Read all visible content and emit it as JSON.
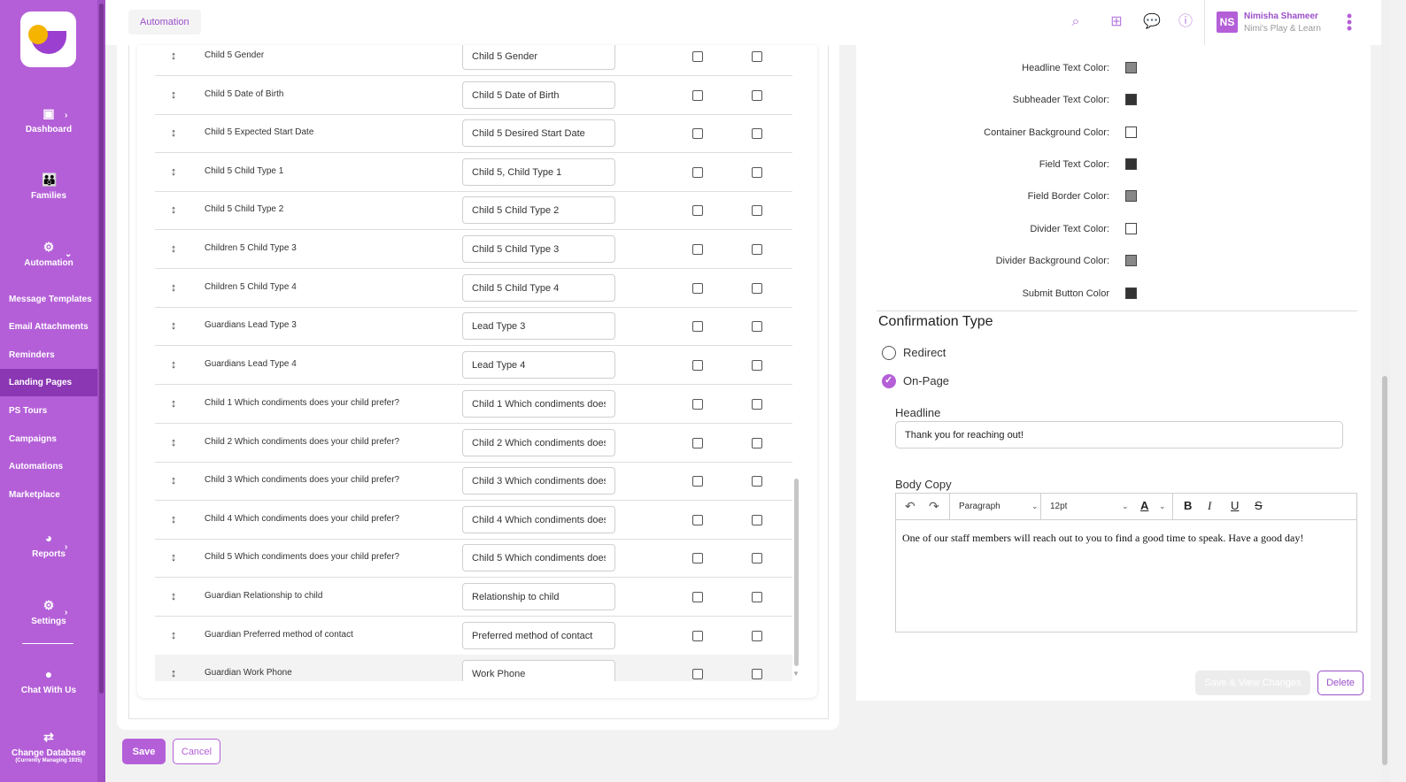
{
  "app": {
    "breadcrumb": "Automation",
    "user": {
      "initials": "NS",
      "name": "Nimisha Shameer",
      "org": "Nimi's Play & Learn"
    }
  },
  "sidebar": {
    "main": [
      {
        "label": "Dashboard",
        "icon": "dashboard-icon"
      },
      {
        "label": "Families",
        "icon": "families-icon"
      },
      {
        "label": "Automation",
        "icon": "automation-icon"
      }
    ],
    "sub": [
      {
        "label": "Message Templates"
      },
      {
        "label": "Email Attachments"
      },
      {
        "label": "Reminders"
      },
      {
        "label": "Landing Pages",
        "active": true
      },
      {
        "label": "PS Tours"
      },
      {
        "label": "Campaigns"
      },
      {
        "label": "Automations"
      },
      {
        "label": "Marketplace"
      }
    ],
    "bottom": [
      {
        "label": "Reports",
        "icon": "reports-icon"
      },
      {
        "label": "Settings",
        "icon": "gear-icon"
      },
      {
        "label": "Chat With Us",
        "icon": "chat-icon"
      },
      {
        "label": "Change Database",
        "sublabel": "(Currently Managing 1935)",
        "icon": "swap-icon"
      }
    ]
  },
  "fields": [
    {
      "name": "Child 5 Gender",
      "label": "Child 5 Gender"
    },
    {
      "name": "Child 5 Date of Birth",
      "label": "Child 5 Date of Birth"
    },
    {
      "name": "Child 5 Expected Start Date",
      "label": "Child 5 Desired Start Date"
    },
    {
      "name": "Child 5 Child Type 1",
      "label": "Child 5, Child Type 1"
    },
    {
      "name": "Child 5 Child Type 2",
      "label": "Child 5 Child Type 2"
    },
    {
      "name": "Children 5 Child Type 3",
      "label": "Child 5 Child Type 3"
    },
    {
      "name": "Children 5 Child Type 4",
      "label": "Child 5 Child Type 4"
    },
    {
      "name": "Guardians Lead Type 3",
      "label": "Lead Type 3"
    },
    {
      "name": "Guardians Lead Type 4",
      "label": "Lead Type 4"
    },
    {
      "name": "Child 1 Which condiments does your child prefer?",
      "label": "Child 1 Which condiments does your child prefer?"
    },
    {
      "name": "Child 2 Which condiments does your child prefer?",
      "label": "Child 2 Which condiments does your child prefer?"
    },
    {
      "name": "Child 3 Which condiments does your child prefer?",
      "label": "Child 3 Which condiments does your child prefer?"
    },
    {
      "name": "Child 4 Which condiments does your child prefer?",
      "label": "Child 4 Which condiments does your child prefer?"
    },
    {
      "name": "Child 5 Which condiments does your child prefer?",
      "label": "Child 5 Which condiments does your child prefer?"
    },
    {
      "name": "Guardian Relationship to child",
      "label": "Relationship to child"
    },
    {
      "name": "Guardian Preferred method of contact",
      "label": "Preferred method of contact"
    },
    {
      "name": "Guardian Work Phone",
      "label": "Work Phone"
    }
  ],
  "buttons": {
    "save": "Save",
    "cancel": "Cancel",
    "save_view": "Save & View Changes",
    "delete": "Delete"
  },
  "colors": [
    {
      "label": "Headline Text Color:",
      "value": "#888888"
    },
    {
      "label": "Subheader Text Color:",
      "value": "#333333"
    },
    {
      "label": "Container Background Color:",
      "value": "#ffffff"
    },
    {
      "label": "Field Text Color:",
      "value": "#333333"
    },
    {
      "label": "Field Border Color:",
      "value": "#888888"
    },
    {
      "label": "Divider Text Color:",
      "value": "#ffffff"
    },
    {
      "label": "Divider Background Color:",
      "value": "#888888"
    },
    {
      "label": "Submit Button Color",
      "value": "#333333"
    }
  ],
  "confirmation": {
    "title": "Confirmation Type",
    "options": [
      {
        "label": "Redirect",
        "checked": false
      },
      {
        "label": "On-Page",
        "checked": true
      }
    ],
    "headline_label": "Headline",
    "headline_value": "Thank you for reaching out!",
    "body_label": "Body Copy",
    "editor": {
      "block_format": "Paragraph",
      "font_size": "12pt",
      "text_color_glyph": "A",
      "bold": "B",
      "italic": "I",
      "underline": "U",
      "strike": "S"
    },
    "body_text": "One of our staff members will reach out to you to find a good time to speak. Have a good day!"
  }
}
